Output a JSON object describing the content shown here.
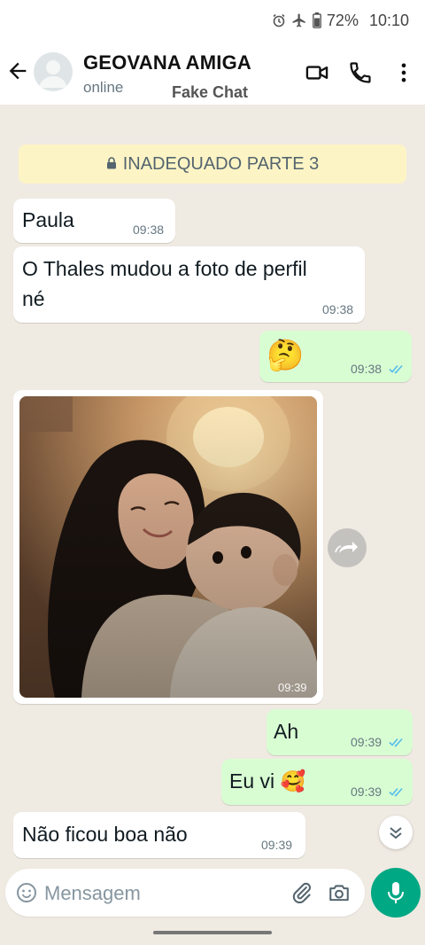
{
  "status_bar": {
    "battery": "72%",
    "time": "10:10",
    "icons": [
      "alarm-icon",
      "airplane-icon",
      "battery-icon"
    ]
  },
  "header": {
    "contact_name": "GEOVANA AMIGA",
    "contact_status": "online",
    "watermark": "Fake Chat",
    "icons": [
      "back-arrow-icon",
      "avatar-placeholder-icon",
      "video-call-icon",
      "phone-icon",
      "more-vert-icon"
    ]
  },
  "chat": {
    "banner": "INADEQUADO PARTE 3",
    "messages": [
      {
        "direction": "in",
        "text": "Paula",
        "time": "09:38"
      },
      {
        "direction": "in",
        "text_line1": "O Thales mudou a foto de perfil",
        "text_line2": "né",
        "time": "09:38"
      },
      {
        "direction": "out",
        "text": "🤔",
        "time": "09:38",
        "status": "read"
      },
      {
        "direction": "in",
        "type": "image",
        "time": "09:39"
      },
      {
        "direction": "out",
        "text": "Ah",
        "time": "09:39",
        "status": "read"
      },
      {
        "direction": "out",
        "text": "Eu vi 🥰",
        "time": "09:39",
        "status": "read"
      },
      {
        "direction": "in",
        "text": "Não ficou boa não",
        "time": "09:39"
      }
    ]
  },
  "composer": {
    "placeholder": "Mensagem",
    "icons": [
      "emoji-icon",
      "attach-icon",
      "camera-icon",
      "mic-icon"
    ]
  },
  "colors": {
    "chat_bg": "#efeae2",
    "outgoing_bubble": "#d9fdd3",
    "incoming_bubble": "#ffffff",
    "banner_bg": "#fdf4c5",
    "accent": "#00a884",
    "read_ticks": "#53bdeb"
  }
}
